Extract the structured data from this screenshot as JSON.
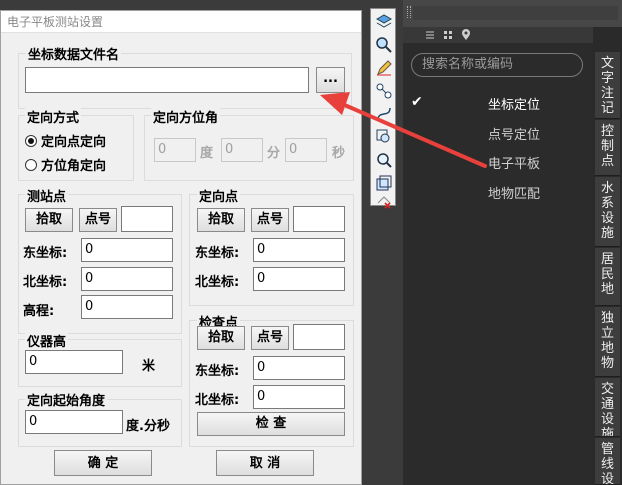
{
  "dialog": {
    "title": "电子平板测站设置",
    "coord_file_label": "坐标数据文件名",
    "coord_file_value": "",
    "browse_label": "...",
    "orient_mode": {
      "label": "定向方式",
      "options": [
        "定向点定向",
        "方位角定向"
      ],
      "selected": 0
    },
    "orient_azimuth": {
      "label": "定向方位角",
      "deg_value": "0",
      "deg_unit": "度",
      "min_value": "0",
      "min_unit": "分",
      "sec_value": "0",
      "sec_unit": "秒"
    },
    "station": {
      "label": "测站点",
      "pick": "拾取",
      "point_no": "点号",
      "point_no_value": "",
      "east_label": "东坐标:",
      "east_value": "0",
      "north_label": "北坐标:",
      "north_value": "0",
      "elev_label": "高程:",
      "elev_value": "0"
    },
    "orient_point": {
      "label": "定向点",
      "pick": "拾取",
      "point_no": "点号",
      "point_no_value": "",
      "east_label": "东坐标:",
      "east_value": "0",
      "north_label": "北坐标:",
      "north_value": "0"
    },
    "instrument": {
      "label": "仪器高",
      "value": "0",
      "unit": "米"
    },
    "start_angle": {
      "label": "定向起始角度",
      "value": "0",
      "unit": "度.分秒"
    },
    "check_point": {
      "label": "检查点",
      "pick": "拾取",
      "point_no": "点号",
      "point_no_value": "",
      "east_label": "东坐标:",
      "east_value": "0",
      "north_label": "北坐标:",
      "north_value": "0",
      "check_button": "检    查"
    },
    "ok_button": "确    定",
    "cancel_button": "取    消"
  },
  "panel": {
    "search_placeholder": "搜索名称或编码",
    "items": [
      "坐标定位",
      "点号定位",
      "电子平板",
      "地物匹配"
    ],
    "selected_index": 0
  },
  "side_tabs": [
    "文字注记",
    "控制点",
    "水系设施",
    "居民地",
    "独立地物",
    "交通设施",
    "管线设"
  ],
  "colors": {
    "annotation_arrow": "#e8403a"
  }
}
